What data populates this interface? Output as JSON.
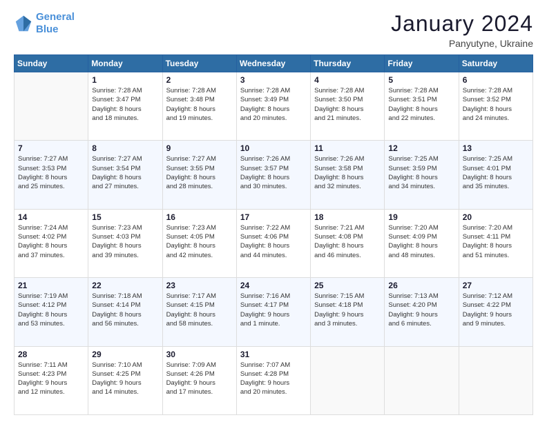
{
  "logo": {
    "line1": "General",
    "line2": "Blue"
  },
  "title": "January 2024",
  "location": "Panyutyne, Ukraine",
  "days_of_week": [
    "Sunday",
    "Monday",
    "Tuesday",
    "Wednesday",
    "Thursday",
    "Friday",
    "Saturday"
  ],
  "weeks": [
    [
      {
        "day": "",
        "info": ""
      },
      {
        "day": "1",
        "info": "Sunrise: 7:28 AM\nSunset: 3:47 PM\nDaylight: 8 hours\nand 18 minutes."
      },
      {
        "day": "2",
        "info": "Sunrise: 7:28 AM\nSunset: 3:48 PM\nDaylight: 8 hours\nand 19 minutes."
      },
      {
        "day": "3",
        "info": "Sunrise: 7:28 AM\nSunset: 3:49 PM\nDaylight: 8 hours\nand 20 minutes."
      },
      {
        "day": "4",
        "info": "Sunrise: 7:28 AM\nSunset: 3:50 PM\nDaylight: 8 hours\nand 21 minutes."
      },
      {
        "day": "5",
        "info": "Sunrise: 7:28 AM\nSunset: 3:51 PM\nDaylight: 8 hours\nand 22 minutes."
      },
      {
        "day": "6",
        "info": "Sunrise: 7:28 AM\nSunset: 3:52 PM\nDaylight: 8 hours\nand 24 minutes."
      }
    ],
    [
      {
        "day": "7",
        "info": "Sunrise: 7:27 AM\nSunset: 3:53 PM\nDaylight: 8 hours\nand 25 minutes."
      },
      {
        "day": "8",
        "info": "Sunrise: 7:27 AM\nSunset: 3:54 PM\nDaylight: 8 hours\nand 27 minutes."
      },
      {
        "day": "9",
        "info": "Sunrise: 7:27 AM\nSunset: 3:55 PM\nDaylight: 8 hours\nand 28 minutes."
      },
      {
        "day": "10",
        "info": "Sunrise: 7:26 AM\nSunset: 3:57 PM\nDaylight: 8 hours\nand 30 minutes."
      },
      {
        "day": "11",
        "info": "Sunrise: 7:26 AM\nSunset: 3:58 PM\nDaylight: 8 hours\nand 32 minutes."
      },
      {
        "day": "12",
        "info": "Sunrise: 7:25 AM\nSunset: 3:59 PM\nDaylight: 8 hours\nand 34 minutes."
      },
      {
        "day": "13",
        "info": "Sunrise: 7:25 AM\nSunset: 4:01 PM\nDaylight: 8 hours\nand 35 minutes."
      }
    ],
    [
      {
        "day": "14",
        "info": "Sunrise: 7:24 AM\nSunset: 4:02 PM\nDaylight: 8 hours\nand 37 minutes."
      },
      {
        "day": "15",
        "info": "Sunrise: 7:23 AM\nSunset: 4:03 PM\nDaylight: 8 hours\nand 39 minutes."
      },
      {
        "day": "16",
        "info": "Sunrise: 7:23 AM\nSunset: 4:05 PM\nDaylight: 8 hours\nand 42 minutes."
      },
      {
        "day": "17",
        "info": "Sunrise: 7:22 AM\nSunset: 4:06 PM\nDaylight: 8 hours\nand 44 minutes."
      },
      {
        "day": "18",
        "info": "Sunrise: 7:21 AM\nSunset: 4:08 PM\nDaylight: 8 hours\nand 46 minutes."
      },
      {
        "day": "19",
        "info": "Sunrise: 7:20 AM\nSunset: 4:09 PM\nDaylight: 8 hours\nand 48 minutes."
      },
      {
        "day": "20",
        "info": "Sunrise: 7:20 AM\nSunset: 4:11 PM\nDaylight: 8 hours\nand 51 minutes."
      }
    ],
    [
      {
        "day": "21",
        "info": "Sunrise: 7:19 AM\nSunset: 4:12 PM\nDaylight: 8 hours\nand 53 minutes."
      },
      {
        "day": "22",
        "info": "Sunrise: 7:18 AM\nSunset: 4:14 PM\nDaylight: 8 hours\nand 56 minutes."
      },
      {
        "day": "23",
        "info": "Sunrise: 7:17 AM\nSunset: 4:15 PM\nDaylight: 8 hours\nand 58 minutes."
      },
      {
        "day": "24",
        "info": "Sunrise: 7:16 AM\nSunset: 4:17 PM\nDaylight: 9 hours\nand 1 minute."
      },
      {
        "day": "25",
        "info": "Sunrise: 7:15 AM\nSunset: 4:18 PM\nDaylight: 9 hours\nand 3 minutes."
      },
      {
        "day": "26",
        "info": "Sunrise: 7:13 AM\nSunset: 4:20 PM\nDaylight: 9 hours\nand 6 minutes."
      },
      {
        "day": "27",
        "info": "Sunrise: 7:12 AM\nSunset: 4:22 PM\nDaylight: 9 hours\nand 9 minutes."
      }
    ],
    [
      {
        "day": "28",
        "info": "Sunrise: 7:11 AM\nSunset: 4:23 PM\nDaylight: 9 hours\nand 12 minutes."
      },
      {
        "day": "29",
        "info": "Sunrise: 7:10 AM\nSunset: 4:25 PM\nDaylight: 9 hours\nand 14 minutes."
      },
      {
        "day": "30",
        "info": "Sunrise: 7:09 AM\nSunset: 4:26 PM\nDaylight: 9 hours\nand 17 minutes."
      },
      {
        "day": "31",
        "info": "Sunrise: 7:07 AM\nSunset: 4:28 PM\nDaylight: 9 hours\nand 20 minutes."
      },
      {
        "day": "",
        "info": ""
      },
      {
        "day": "",
        "info": ""
      },
      {
        "day": "",
        "info": ""
      }
    ]
  ]
}
